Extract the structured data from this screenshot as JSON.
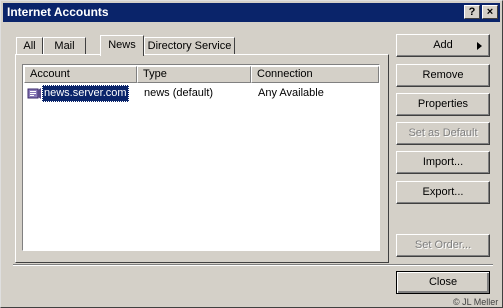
{
  "window": {
    "title": "Internet Accounts",
    "help_label": "?",
    "close_label": "×"
  },
  "tabs": [
    {
      "label": "All",
      "selected": false
    },
    {
      "label": "Mail",
      "selected": false
    },
    {
      "label": "News",
      "selected": true
    },
    {
      "label": "Directory Service",
      "selected": false
    }
  ],
  "list": {
    "columns": [
      "Account",
      "Type",
      "Connection"
    ],
    "rows": [
      {
        "account": "news.server.com",
        "type": "news (default)",
        "connection": "Any Available",
        "icon": "news-account-icon",
        "selected": true
      }
    ]
  },
  "buttons": {
    "add": "Add",
    "remove": "Remove",
    "properties": "Properties",
    "set_default": "Set as Default",
    "import": "Import...",
    "export": "Export...",
    "set_order": "Set Order...",
    "close": "Close"
  },
  "footer": {
    "copyright": "© JL Meller"
  },
  "colors": {
    "titlebar": "#0a246a",
    "face": "#d4d0c8",
    "selection": "#0a246a"
  }
}
